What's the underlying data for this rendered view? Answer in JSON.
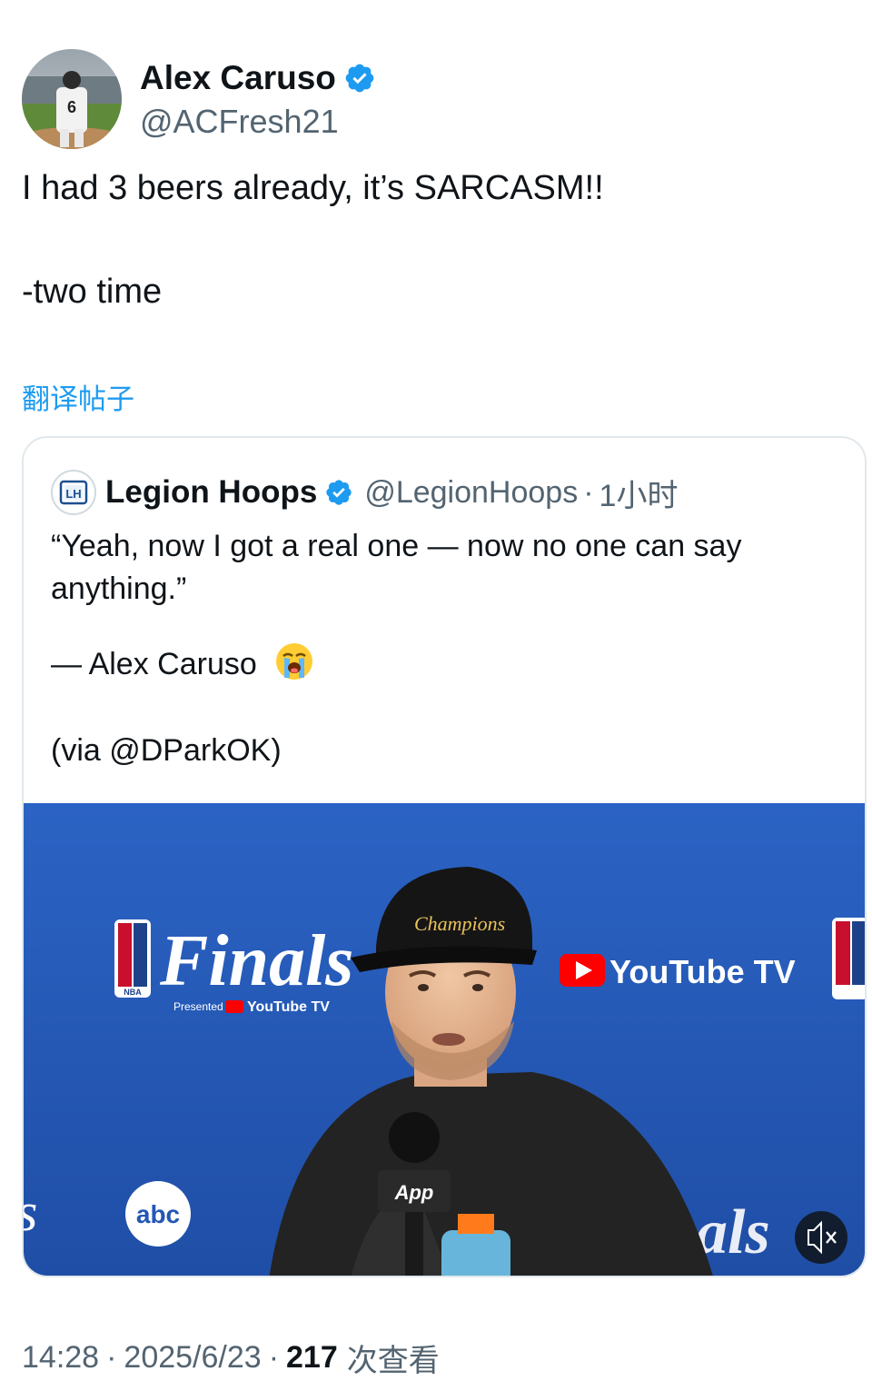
{
  "tweet": {
    "author": {
      "display_name": "Alex Caruso",
      "handle": "@ACFresh21",
      "avatar_jersey_number": "6"
    },
    "text_paragraphs": [
      "I had 3 beers already, it’s SARCASM!!",
      "-two time"
    ],
    "translate_label": "翻译帖子",
    "quoted": {
      "display_name": "Legion Hoops",
      "handle": "@LegionHoops",
      "separator": "·",
      "time": "1小时",
      "avatar_initials": "LH",
      "text_line1": "“Yeah, now I got a real one — now no one can say anything.”",
      "text_line2": "— Alex Caruso",
      "text_line3": "(via @DParkOK)",
      "emoji_name": "loudly-crying-face-emoji",
      "media": {
        "finals_logo_text": "Finals",
        "finals_presented_text": "Presented by",
        "youtube_tv_text": "YouTube TV",
        "nba_text": "NBA",
        "hat_text": "Champions",
        "mic_text": "App",
        "abc_text": "abc",
        "right_partial_text": "als",
        "mute_icon": "muted-speaker-icon"
      }
    },
    "meta": {
      "time": "14:28",
      "date": "2025/6/23",
      "dot": "·",
      "views_count": "217",
      "views_label": "次查看"
    }
  },
  "colors": {
    "link_blue": "#1d9bf0",
    "verified_blue": "#1d9bf0",
    "backdrop_blue": "#2457b5",
    "secondary_gray": "#536471"
  }
}
